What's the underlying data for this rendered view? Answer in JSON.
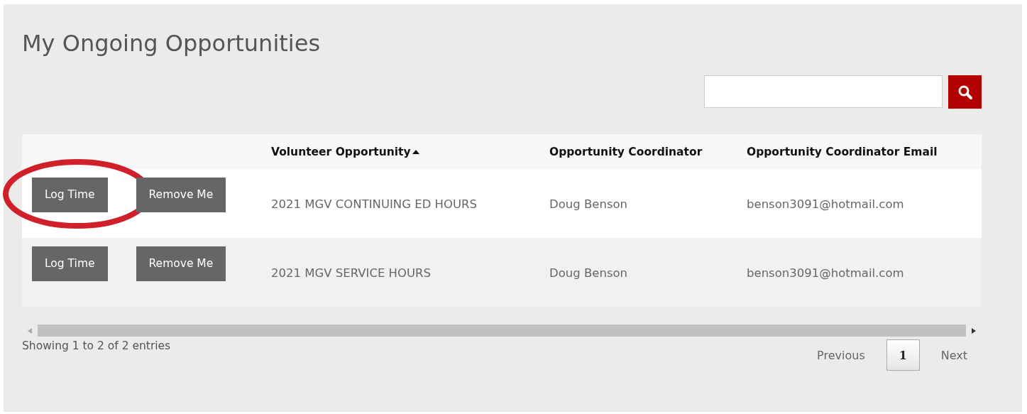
{
  "title": "My Ongoing Opportunities",
  "table": {
    "columns": [
      {
        "label": "Volunteer Opportunity",
        "sorted": true
      },
      {
        "label": "Opportunity Coordinator",
        "sorted": false
      },
      {
        "label": "Opportunity Coordinator Email",
        "sorted": false
      }
    ],
    "rows": [
      {
        "actions": [
          "Log Time",
          "Remove Me"
        ],
        "opportunity": "2021 MGV CONTINUING ED HOURS",
        "coordinator": "Doug Benson",
        "email": "benson3091@hotmail.com",
        "highlighted": true
      },
      {
        "actions": [
          "Log Time",
          "Remove Me"
        ],
        "opportunity": "2021 MGV SERVICE HOURS",
        "coordinator": "Doug Benson",
        "email": "benson3091@hotmail.com",
        "highlighted": false
      }
    ]
  },
  "info": "Showing 1 to 2 of 2 entries",
  "pagination": {
    "previous": "Previous",
    "pages": [
      {
        "label": "1",
        "selected": true
      }
    ],
    "next": "Next"
  }
}
